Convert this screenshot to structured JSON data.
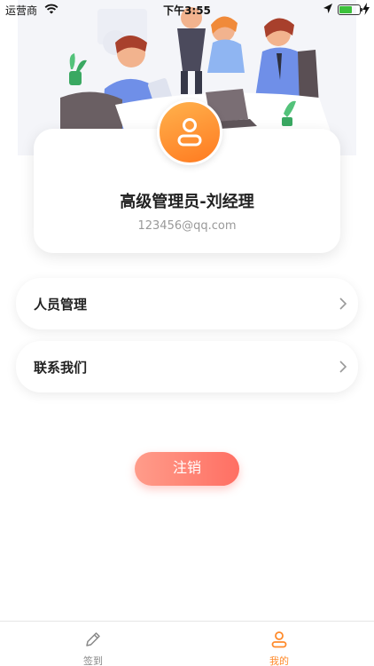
{
  "status_bar": {
    "carrier": "运营商",
    "time": "下午3:55",
    "battery_level": 0.62
  },
  "profile": {
    "name": "高级管理员-刘经理",
    "email": "123456@qq.com"
  },
  "menu": {
    "items": [
      {
        "label": "人员管理"
      },
      {
        "label": "联系我们"
      }
    ]
  },
  "logout": {
    "label": "注销"
  },
  "tabs": [
    {
      "label": "签到",
      "icon": "pencil-icon",
      "active": false
    },
    {
      "label": "我的",
      "icon": "user-icon",
      "active": true
    }
  ],
  "colors": {
    "accent": "#ff8a2a",
    "logout_start": "#ff9c8a",
    "logout_end": "#ff6f63",
    "tab_inactive": "#888888"
  }
}
